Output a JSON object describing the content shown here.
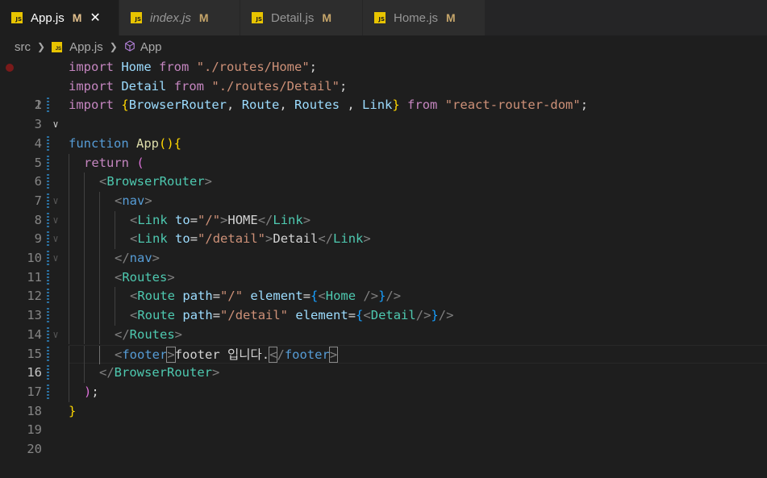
{
  "tabs": [
    {
      "name": "App.js",
      "status": "M",
      "active": true,
      "close": "✕"
    },
    {
      "name": "index.js",
      "status": "M",
      "active": false
    },
    {
      "name": "Detail.js",
      "status": "M",
      "active": false
    },
    {
      "name": "Home.js",
      "status": "M",
      "active": false
    }
  ],
  "js_badge": "JS",
  "breadcrumb": {
    "folder": "src",
    "file": "App.js",
    "symbol": "App"
  },
  "line_numbers": [
    "1",
    "2",
    "3",
    "4",
    "5",
    "6",
    "7",
    "8",
    "9",
    "10",
    "11",
    "12",
    "13",
    "14",
    "15",
    "16",
    "17",
    "18",
    "19",
    "20"
  ],
  "current_line": 16,
  "code": {
    "l1": {
      "import": "import",
      "name": "Home",
      "from": "from",
      "path": "\"./routes/Home\"",
      "semi": ";"
    },
    "l2": {
      "import": "import",
      "name": "Detail",
      "from": "from",
      "path": "\"./routes/Detail\"",
      "semi": ";"
    },
    "l3": {
      "import": "import",
      "open": "{",
      "n1": "BrowserRouter",
      "n2": "Route",
      "n3": "Routes",
      "n4": "Link",
      "close": "}",
      "from": "from",
      "path": "\"react-router-dom\"",
      "semi": ";"
    },
    "l5": {
      "kw": "function",
      "name": "App",
      "paren": "()",
      "brace": "{"
    },
    "l6": {
      "kw": "return",
      "paren": "("
    },
    "l7": {
      "tag": "BrowserRouter"
    },
    "l8": {
      "tag": "nav"
    },
    "l9": {
      "tag": "Link",
      "attr": "to",
      "val": "\"/\"",
      "text": "HOME"
    },
    "l10": {
      "tag": "Link",
      "attr": "to",
      "val": "\"/detail\"",
      "text": "Detail"
    },
    "l11": {
      "tag": "nav"
    },
    "l12": {
      "tag": "Routes"
    },
    "l13": {
      "tag": "Route",
      "attr1": "path",
      "val1": "\"/\"",
      "attr2": "element",
      "inner": "Home"
    },
    "l14": {
      "tag": "Route",
      "attr1": "path",
      "val1": "\"/detail\"",
      "attr2": "element",
      "inner": "Detail"
    },
    "l15": {
      "tag": "Routes"
    },
    "l16": {
      "tag": "footer",
      "text": "footer 입니다."
    },
    "l17": {
      "tag": "BrowserRouter"
    },
    "l18": {
      "paren": ")",
      "semi": ";"
    },
    "l19": {
      "brace": "}"
    }
  },
  "colors": {
    "keyword": "#c586c0",
    "function_keyword": "#569cd6",
    "variable": "#9cdcfe",
    "string": "#ce9178",
    "function_name": "#dcdcaa",
    "tag": "#4ec9b0",
    "modified": "#e2c08d"
  }
}
